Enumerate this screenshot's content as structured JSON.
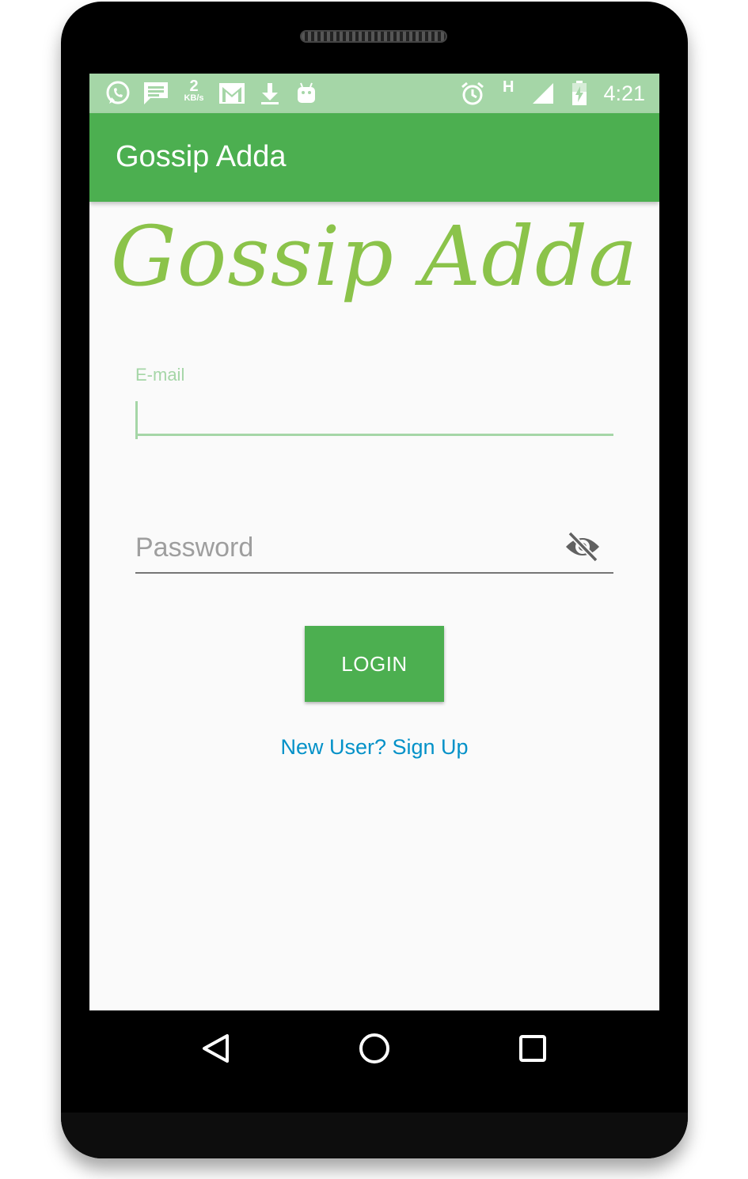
{
  "status_bar": {
    "time": "4:21",
    "network_speed_value": "2",
    "network_speed_unit": "KB/s",
    "network_type": "H",
    "icons": [
      "whatsapp-icon",
      "message-icon",
      "gmail-icon",
      "download-icon",
      "android-icon",
      "alarm-icon",
      "signal-icon",
      "battery-charging-icon"
    ]
  },
  "app_bar": {
    "title": "Gossip Adda"
  },
  "logo": {
    "text": "Gossip Adda",
    "color": "#8bc34a"
  },
  "form": {
    "email_label": "E-mail",
    "email_value": "",
    "password_placeholder": "Password",
    "password_value": "",
    "password_toggle_icon": "visibility-off-icon",
    "login_label": "LOGIN",
    "signup_text": "New User? Sign Up"
  },
  "nav_bar": {
    "buttons": [
      "back-icon",
      "home-icon",
      "recents-icon"
    ]
  },
  "colors": {
    "primary": "#4caf50",
    "status_bar": "#a5d6a7",
    "link": "#0391c8"
  }
}
